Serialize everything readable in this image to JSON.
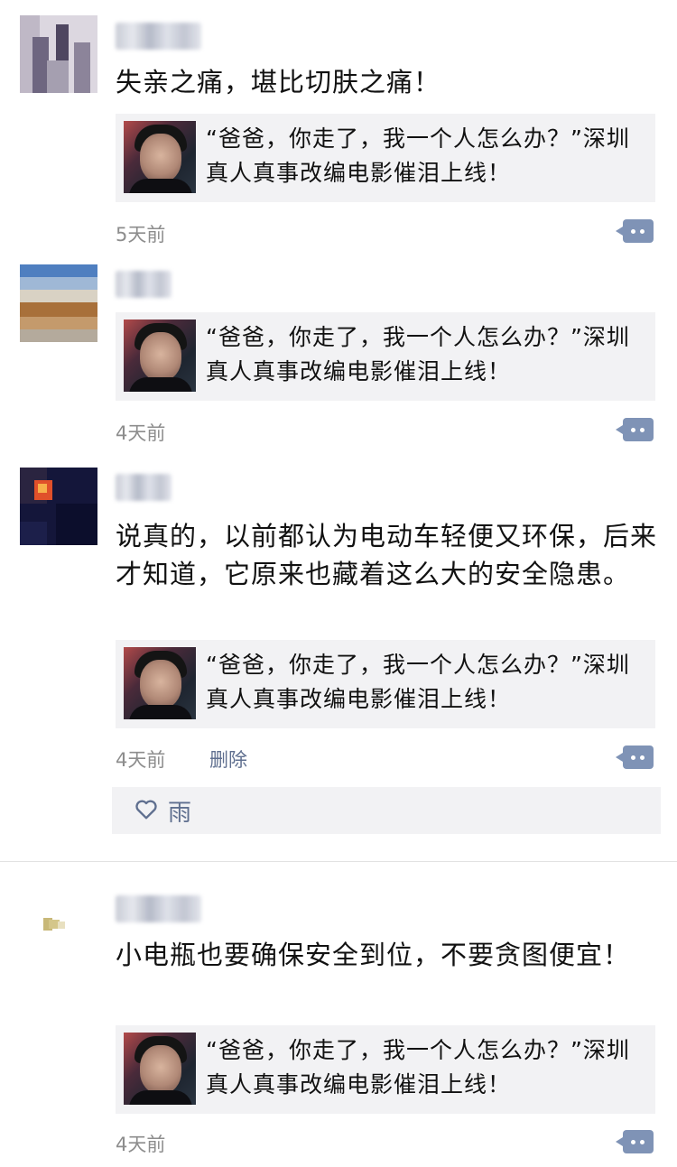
{
  "shared_card_title": "“爸爸，你走了，我一个人怎么办？”深圳真人真事改编电影催泪上线！",
  "posts": [
    {
      "text": "失亲之痛，堪比切肤之痛！",
      "time": "5天前"
    },
    {
      "text": "",
      "time": "4天前"
    },
    {
      "text": "说真的，以前都认为电动车轻便又环保，后来才知道，它原来也藏着这么大的安全隐患。",
      "time": "4天前",
      "delete_label": "删除",
      "likes": [
        "雨"
      ]
    },
    {
      "text": "小电瓶也要确保安全到位，不要贪图便宜！",
      "time": "4天前"
    }
  ],
  "colors": {
    "link": "#5f6f8f",
    "comment_button": "#7f93b6",
    "card_bg": "#f2f2f4"
  },
  "icons": {
    "comment": "comment-bubble-icon",
    "like": "heart-outline-icon"
  }
}
